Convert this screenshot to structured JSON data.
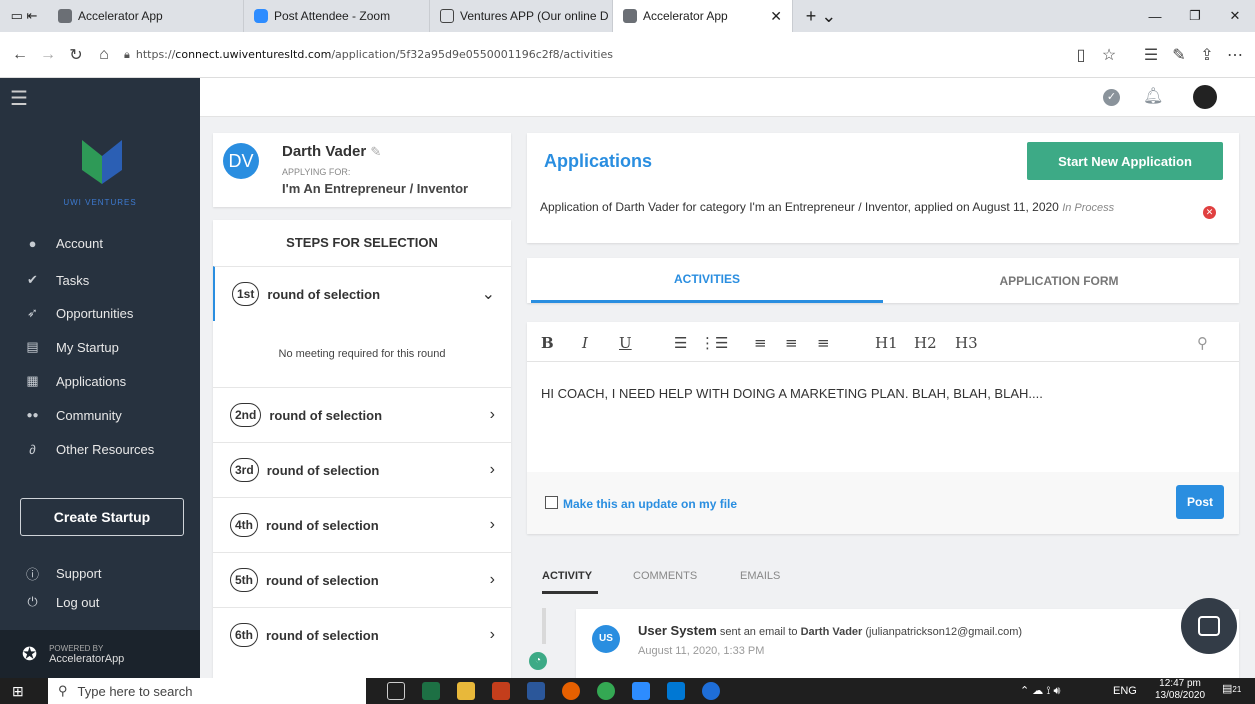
{
  "browser": {
    "tabs": [
      {
        "label": "Accelerator App",
        "color": "#6b6f75"
      },
      {
        "label": "Post Attendee - Zoom",
        "color": "#2d8cff"
      },
      {
        "label": "Ventures APP (Our online D",
        "color": "#444"
      },
      {
        "label": "Accelerator App",
        "color": "#6b6f75"
      }
    ],
    "url_prefix": "https://",
    "url_host": "connect.uwiventuresltd.com",
    "url_path": "/application/5f32a95d9e0550001196c2f8/activities"
  },
  "sidebar": {
    "logo_text": "UWI VENTURES",
    "items": [
      {
        "label": "Account",
        "icon": "user-icon"
      },
      {
        "label": "Tasks",
        "icon": "check-circle-icon"
      },
      {
        "label": "Opportunities",
        "icon": "rocket-icon"
      },
      {
        "label": "My Startup",
        "icon": "file-icon"
      },
      {
        "label": "Applications",
        "icon": "building-icon"
      },
      {
        "label": "Community",
        "icon": "users-icon"
      },
      {
        "label": "Other Resources",
        "icon": "link-icon"
      }
    ],
    "create_label": "Create Startup",
    "support_label": "Support",
    "logout_label": "Log out",
    "powered_by": "POWERED BY",
    "powered_name": "AcceleratorApp"
  },
  "profile": {
    "initials": "DV",
    "name": "Darth Vader",
    "applying_for": "APPLYING FOR:",
    "category": "I'm An Entrepreneur / Inventor"
  },
  "steps": {
    "title": "STEPS FOR SELECTION",
    "items": [
      {
        "ordinal": "1st",
        "label": "round of selection"
      },
      {
        "ordinal": "2nd",
        "label": "round of selection"
      },
      {
        "ordinal": "3rd",
        "label": "round of selection"
      },
      {
        "ordinal": "4th",
        "label": "round of selection"
      },
      {
        "ordinal": "5th",
        "label": "round of selection"
      },
      {
        "ordinal": "6th",
        "label": "round of selection"
      }
    ],
    "no_meeting": "No meeting required for this round"
  },
  "applications": {
    "title": "Applications",
    "start_button": "Start New Application",
    "description": "Application of Darth Vader for category I'm an Entrepreneur / Inventor, applied on August 11, 2020",
    "status": "In Process"
  },
  "content_tabs": {
    "activities": "ACTIVITIES",
    "form": "APPLICATION FORM"
  },
  "editor": {
    "text": "HI COACH, I NEED HELP WITH DOING A MARKETING PLAN. BLAH, BLAH, BLAH....",
    "checkbox_label": "Make this an update on my file",
    "post_label": "Post",
    "toolbar": [
      "B",
      "I",
      "U",
      "H1",
      "H2",
      "H3"
    ]
  },
  "activity": {
    "tabs": [
      "ACTIVITY",
      "COMMENTS",
      "EMAILS"
    ],
    "entry_initials": "US",
    "entry_actor": "User System",
    "entry_action": "sent an email to",
    "entry_target": "Darth Vader",
    "entry_email": "(julianpatrickson12@gmail.com)",
    "entry_date": "August 11, 2020, 1:33 PM"
  },
  "taskbar": {
    "search_placeholder": "Type here to search",
    "lang": "ENG",
    "time": "12:47 pm",
    "date": "13/08/2020",
    "notif_count": "21"
  },
  "colors": {
    "accent": "#2a8ee0",
    "green": "#3daa86",
    "sidebar": "#27323f",
    "danger": "#e04040"
  }
}
